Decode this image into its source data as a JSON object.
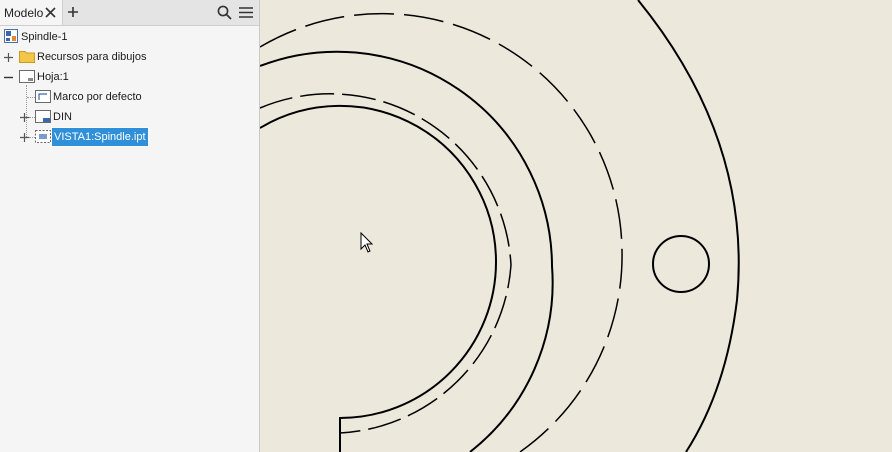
{
  "browser": {
    "tab_label": "Modelo",
    "icons": [
      "close-icon",
      "add-icon",
      "search-icon",
      "menu-icon"
    ],
    "tree": [
      {
        "label": "Spindle-1",
        "icon": "drawing-doc-icon"
      },
      {
        "label": "Recursos para dibujos",
        "icon": "folder-icon",
        "expander": "plus"
      },
      {
        "label": "Hoja:1",
        "icon": "sheet-icon",
        "expander": "minus"
      },
      {
        "label": "Marco por defecto",
        "icon": "border-icon"
      },
      {
        "label": "DIN",
        "icon": "title-block-icon",
        "expander": "plus"
      },
      {
        "label": "VISTA1:Spindle.ipt",
        "icon": "drawing-view-icon",
        "expander": "plus",
        "selected": true
      }
    ]
  },
  "colors": {
    "canvas_background": "#ECE9DC",
    "panel_background": "#F5F5F5",
    "selection": "#2F8FD8",
    "drawing_lines": "#000000"
  }
}
